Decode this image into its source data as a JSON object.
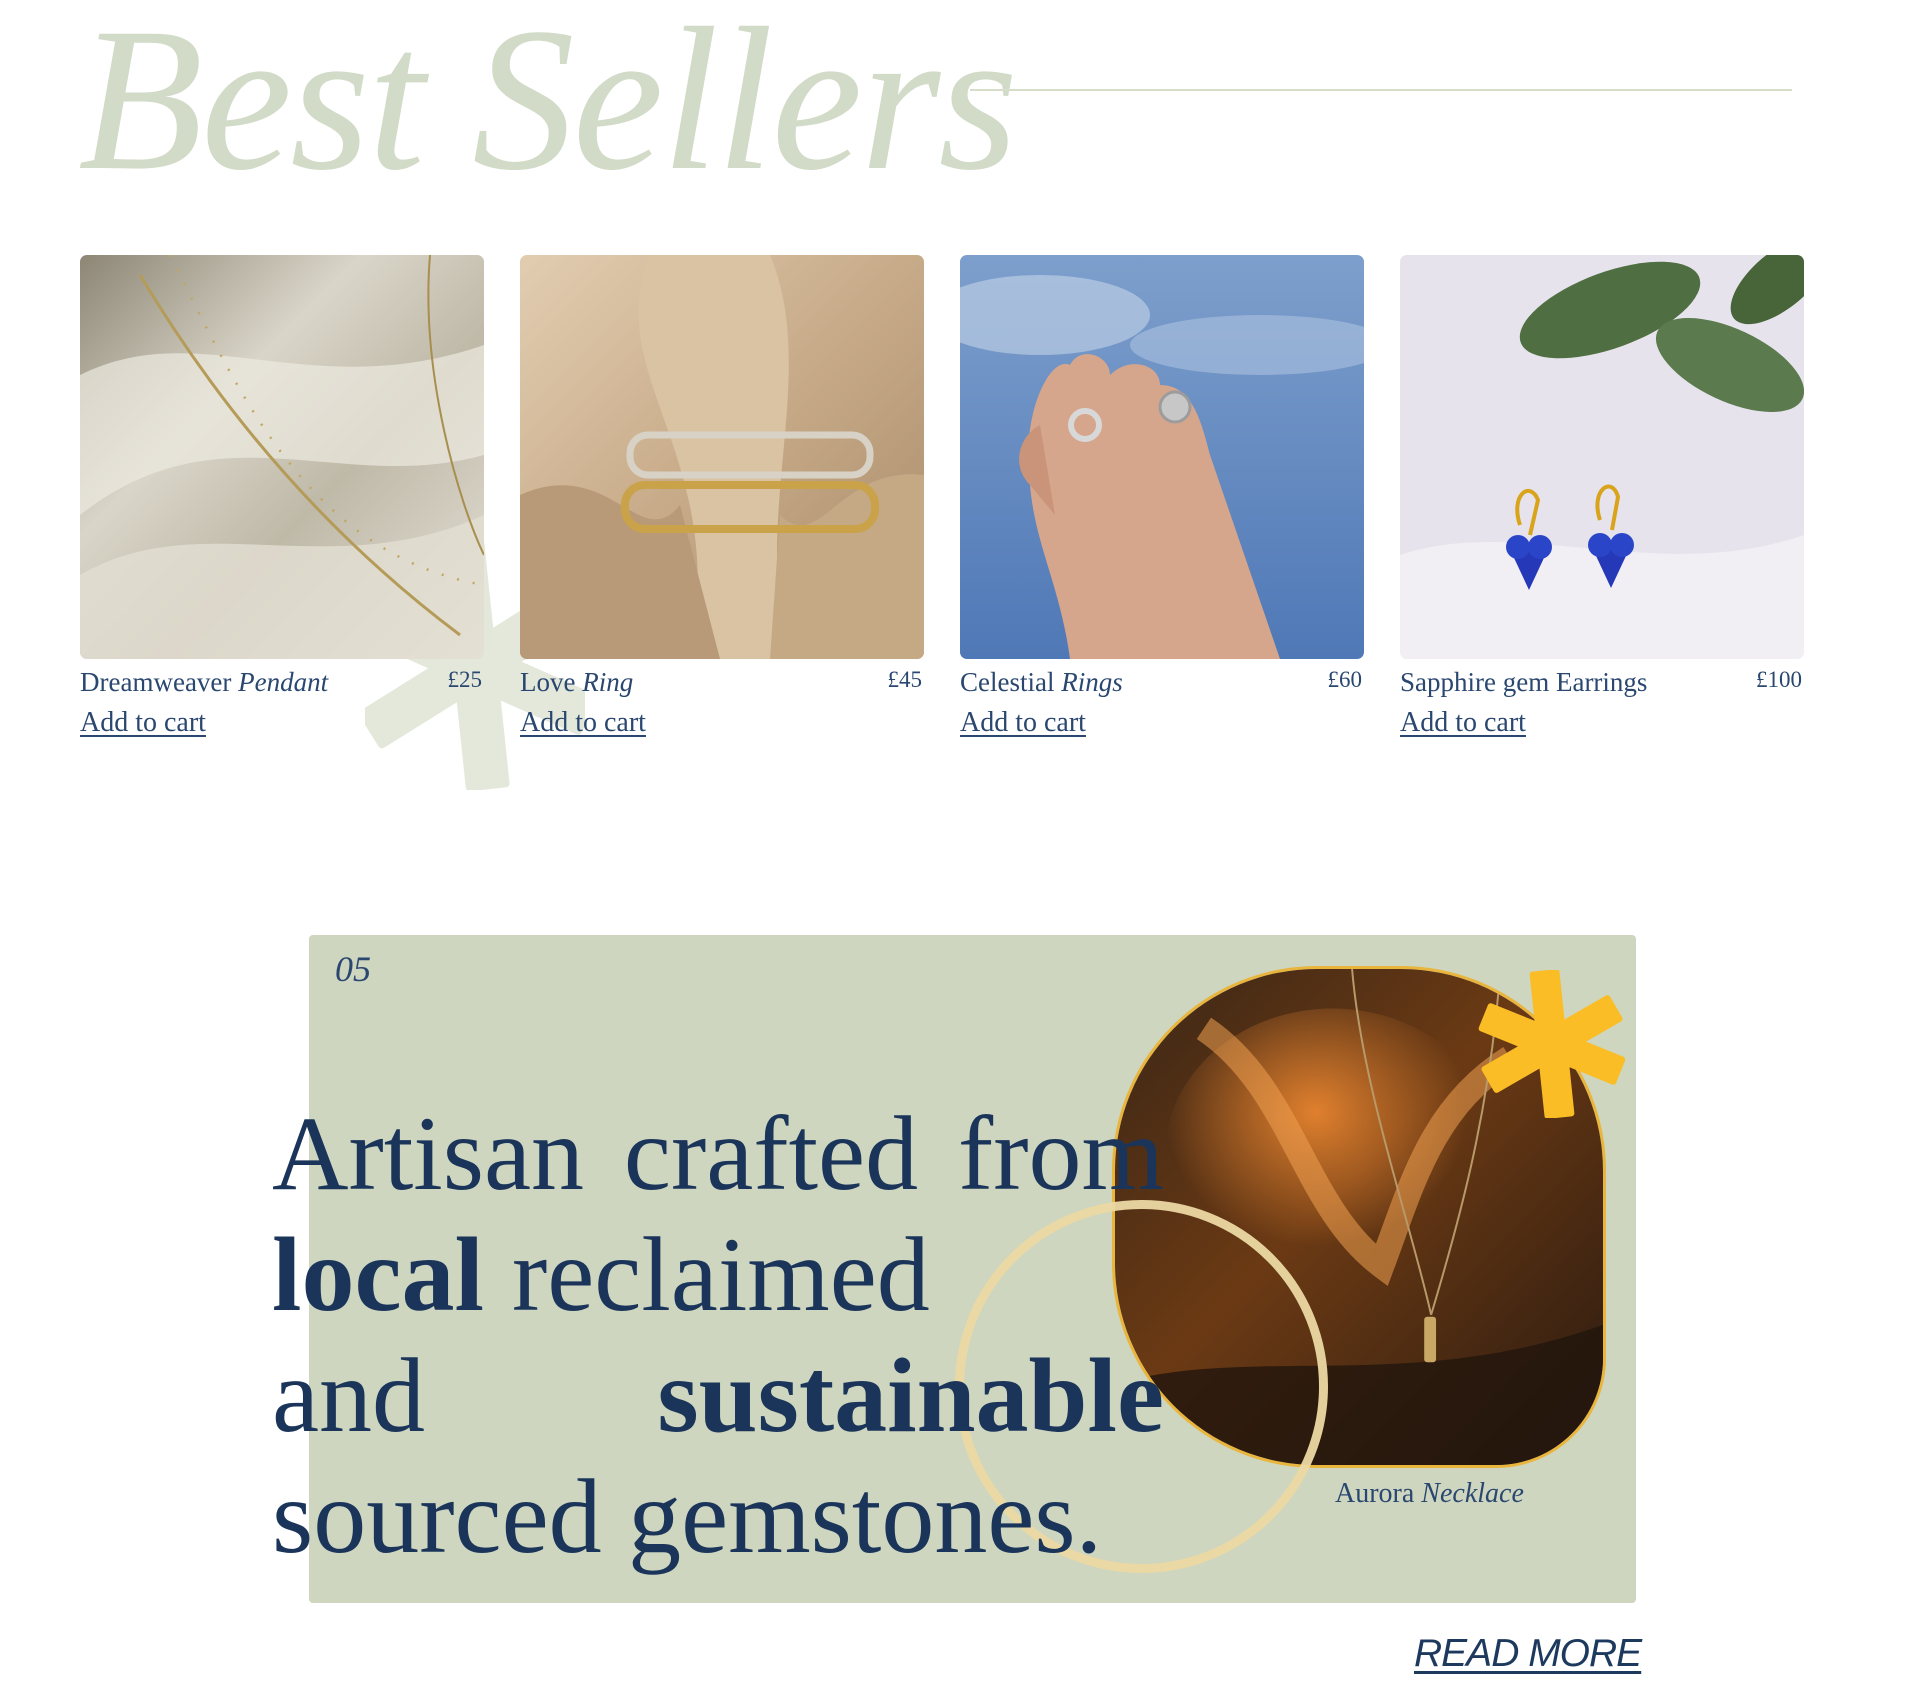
{
  "header": {
    "title": "Best Sellers"
  },
  "products": [
    {
      "name": "Dreamweaver",
      "name_italic": "Pendant",
      "price": "£25",
      "cart_label": "Add to cart"
    },
    {
      "name": "Love",
      "name_italic": "Ring",
      "price": "£45",
      "cart_label": "Add to cart"
    },
    {
      "name": "Celestial",
      "name_italic": "Rings",
      "price": "£60",
      "cart_label": "Add to cart"
    },
    {
      "name": "Sapphire gem Earrings",
      "name_italic": "",
      "price": "£100",
      "cart_label": "Add to cart"
    }
  ],
  "feature": {
    "number": "05",
    "line1": [
      "Artisan",
      "crafted",
      "from"
    ],
    "line2_bold": "local",
    "line2_rest": "reclaimed",
    "line3_start": "and",
    "line3_bold": "sustainable",
    "line4": "sourced gemstones.",
    "caption_name": "Aurora",
    "caption_italic": "Necklace",
    "read_more": "READ MORE"
  },
  "colors": {
    "title_sage": "#d1dbc7",
    "panel_sage": "#ced6bf",
    "navy": "#1b355a",
    "accent_yellow": "#fbbd26"
  }
}
